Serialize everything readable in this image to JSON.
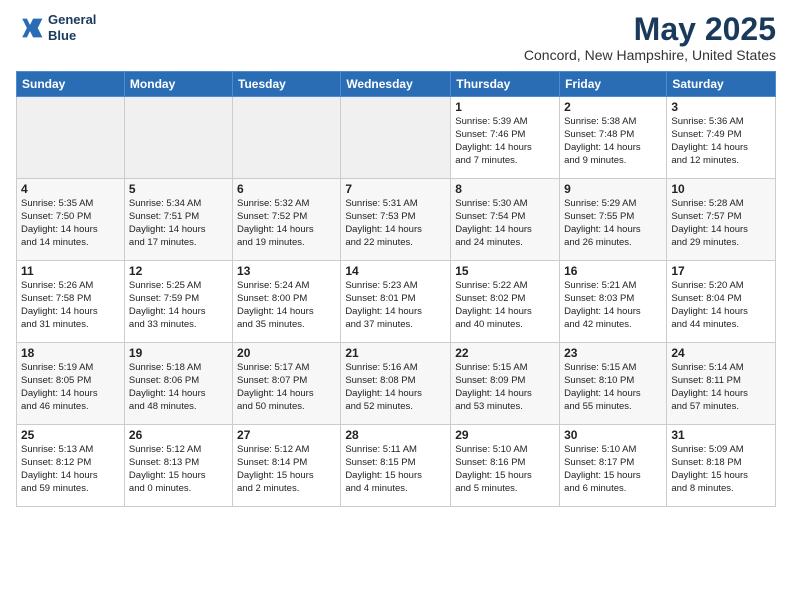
{
  "header": {
    "logo_line1": "General",
    "logo_line2": "Blue",
    "month_title": "May 2025",
    "location": "Concord, New Hampshire, United States"
  },
  "weekdays": [
    "Sunday",
    "Monday",
    "Tuesday",
    "Wednesday",
    "Thursday",
    "Friday",
    "Saturday"
  ],
  "weeks": [
    [
      {
        "num": "",
        "info": ""
      },
      {
        "num": "",
        "info": ""
      },
      {
        "num": "",
        "info": ""
      },
      {
        "num": "",
        "info": ""
      },
      {
        "num": "1",
        "info": "Sunrise: 5:39 AM\nSunset: 7:46 PM\nDaylight: 14 hours\nand 7 minutes."
      },
      {
        "num": "2",
        "info": "Sunrise: 5:38 AM\nSunset: 7:48 PM\nDaylight: 14 hours\nand 9 minutes."
      },
      {
        "num": "3",
        "info": "Sunrise: 5:36 AM\nSunset: 7:49 PM\nDaylight: 14 hours\nand 12 minutes."
      }
    ],
    [
      {
        "num": "4",
        "info": "Sunrise: 5:35 AM\nSunset: 7:50 PM\nDaylight: 14 hours\nand 14 minutes."
      },
      {
        "num": "5",
        "info": "Sunrise: 5:34 AM\nSunset: 7:51 PM\nDaylight: 14 hours\nand 17 minutes."
      },
      {
        "num": "6",
        "info": "Sunrise: 5:32 AM\nSunset: 7:52 PM\nDaylight: 14 hours\nand 19 minutes."
      },
      {
        "num": "7",
        "info": "Sunrise: 5:31 AM\nSunset: 7:53 PM\nDaylight: 14 hours\nand 22 minutes."
      },
      {
        "num": "8",
        "info": "Sunrise: 5:30 AM\nSunset: 7:54 PM\nDaylight: 14 hours\nand 24 minutes."
      },
      {
        "num": "9",
        "info": "Sunrise: 5:29 AM\nSunset: 7:55 PM\nDaylight: 14 hours\nand 26 minutes."
      },
      {
        "num": "10",
        "info": "Sunrise: 5:28 AM\nSunset: 7:57 PM\nDaylight: 14 hours\nand 29 minutes."
      }
    ],
    [
      {
        "num": "11",
        "info": "Sunrise: 5:26 AM\nSunset: 7:58 PM\nDaylight: 14 hours\nand 31 minutes."
      },
      {
        "num": "12",
        "info": "Sunrise: 5:25 AM\nSunset: 7:59 PM\nDaylight: 14 hours\nand 33 minutes."
      },
      {
        "num": "13",
        "info": "Sunrise: 5:24 AM\nSunset: 8:00 PM\nDaylight: 14 hours\nand 35 minutes."
      },
      {
        "num": "14",
        "info": "Sunrise: 5:23 AM\nSunset: 8:01 PM\nDaylight: 14 hours\nand 37 minutes."
      },
      {
        "num": "15",
        "info": "Sunrise: 5:22 AM\nSunset: 8:02 PM\nDaylight: 14 hours\nand 40 minutes."
      },
      {
        "num": "16",
        "info": "Sunrise: 5:21 AM\nSunset: 8:03 PM\nDaylight: 14 hours\nand 42 minutes."
      },
      {
        "num": "17",
        "info": "Sunrise: 5:20 AM\nSunset: 8:04 PM\nDaylight: 14 hours\nand 44 minutes."
      }
    ],
    [
      {
        "num": "18",
        "info": "Sunrise: 5:19 AM\nSunset: 8:05 PM\nDaylight: 14 hours\nand 46 minutes."
      },
      {
        "num": "19",
        "info": "Sunrise: 5:18 AM\nSunset: 8:06 PM\nDaylight: 14 hours\nand 48 minutes."
      },
      {
        "num": "20",
        "info": "Sunrise: 5:17 AM\nSunset: 8:07 PM\nDaylight: 14 hours\nand 50 minutes."
      },
      {
        "num": "21",
        "info": "Sunrise: 5:16 AM\nSunset: 8:08 PM\nDaylight: 14 hours\nand 52 minutes."
      },
      {
        "num": "22",
        "info": "Sunrise: 5:15 AM\nSunset: 8:09 PM\nDaylight: 14 hours\nand 53 minutes."
      },
      {
        "num": "23",
        "info": "Sunrise: 5:15 AM\nSunset: 8:10 PM\nDaylight: 14 hours\nand 55 minutes."
      },
      {
        "num": "24",
        "info": "Sunrise: 5:14 AM\nSunset: 8:11 PM\nDaylight: 14 hours\nand 57 minutes."
      }
    ],
    [
      {
        "num": "25",
        "info": "Sunrise: 5:13 AM\nSunset: 8:12 PM\nDaylight: 14 hours\nand 59 minutes."
      },
      {
        "num": "26",
        "info": "Sunrise: 5:12 AM\nSunset: 8:13 PM\nDaylight: 15 hours\nand 0 minutes."
      },
      {
        "num": "27",
        "info": "Sunrise: 5:12 AM\nSunset: 8:14 PM\nDaylight: 15 hours\nand 2 minutes."
      },
      {
        "num": "28",
        "info": "Sunrise: 5:11 AM\nSunset: 8:15 PM\nDaylight: 15 hours\nand 4 minutes."
      },
      {
        "num": "29",
        "info": "Sunrise: 5:10 AM\nSunset: 8:16 PM\nDaylight: 15 hours\nand 5 minutes."
      },
      {
        "num": "30",
        "info": "Sunrise: 5:10 AM\nSunset: 8:17 PM\nDaylight: 15 hours\nand 6 minutes."
      },
      {
        "num": "31",
        "info": "Sunrise: 5:09 AM\nSunset: 8:18 PM\nDaylight: 15 hours\nand 8 minutes."
      }
    ]
  ]
}
